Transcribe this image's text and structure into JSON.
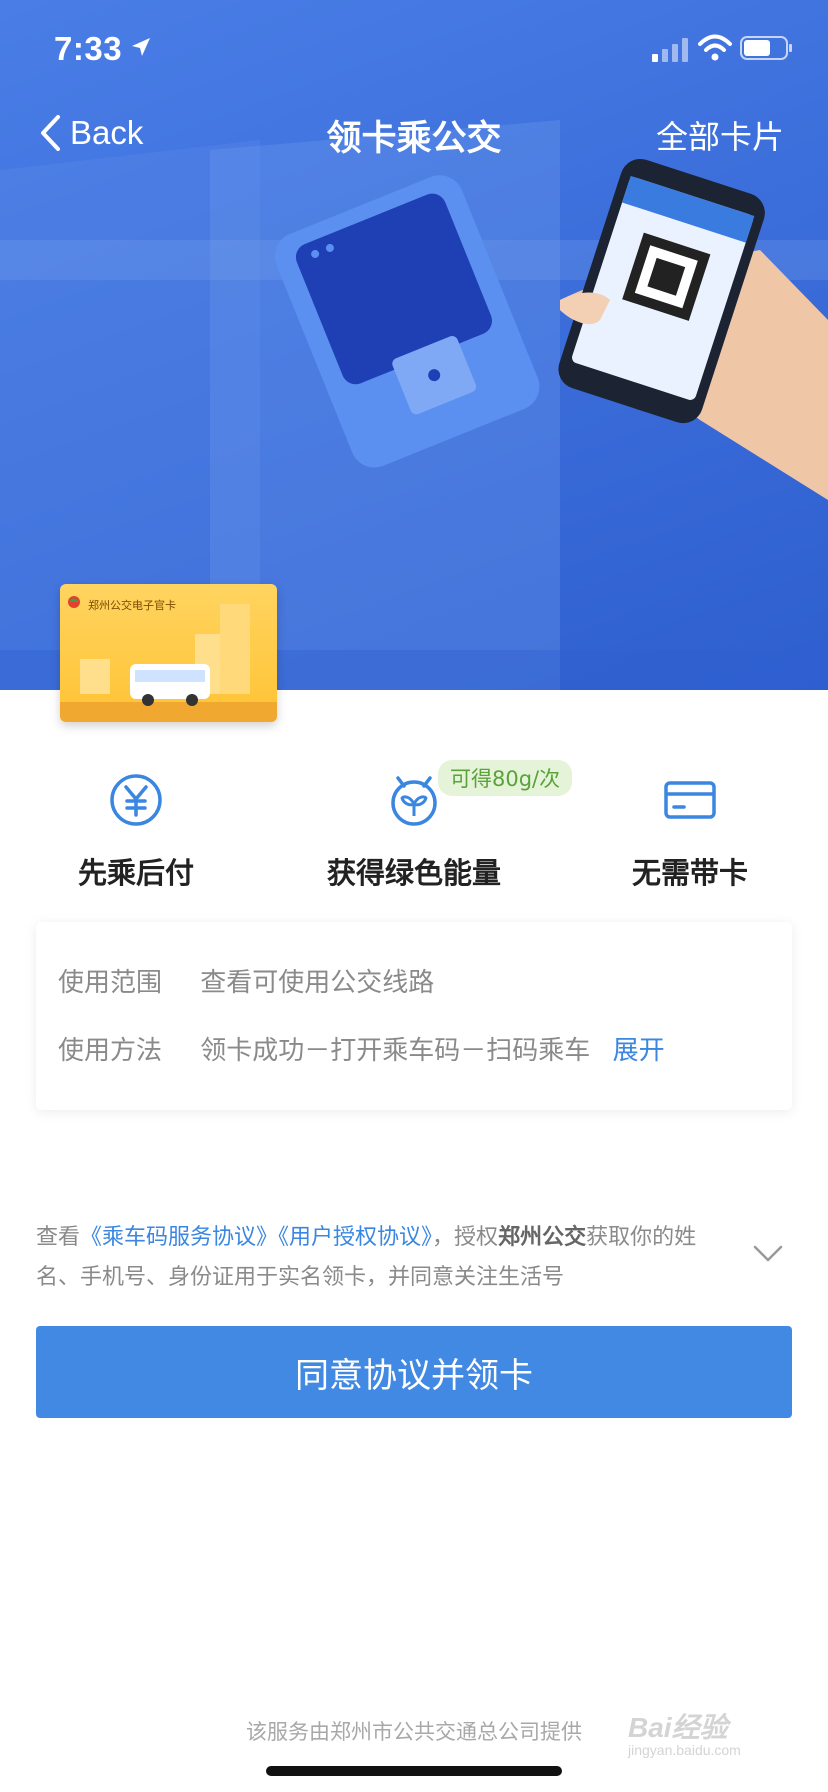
{
  "status_bar": {
    "time": "7:33"
  },
  "nav": {
    "back_label": "Back",
    "title": "领卡乘公交",
    "all_cards": "全部卡片"
  },
  "card": {
    "brand": "郑州公交电子官卡"
  },
  "features": [
    {
      "label": "先乘后付",
      "icon": "yuan-icon"
    },
    {
      "label": "获得绿色能量",
      "icon": "sprout-icon",
      "badge": "可得80g/次"
    },
    {
      "label": "无需带卡",
      "icon": "card-icon"
    }
  ],
  "info": {
    "scope_label": "使用范围",
    "scope_link": "查看可使用公交线路",
    "method_label": "使用方法",
    "method_text": "领卡成功－打开乘车码－扫码乘车",
    "method_expand": "展开"
  },
  "agreement": {
    "prefix": "查看",
    "link1": "《乘车码服务协议》",
    "link2": "《用户授权协议》",
    "mid": "，授权",
    "company": "郑州公交",
    "suffix": "获取你的姓名、手机号、身份证用于实名领卡，并同意关注生活号"
  },
  "cta_label": "同意协议并领卡",
  "footer": "该服务由郑州市公共交通总公司提供",
  "watermark": {
    "main": "Bai经验",
    "sub": "jingyan.baidu.com"
  },
  "colors": {
    "hero": "#3d6fdc",
    "accent": "#4289e3",
    "badge_bg": "#e5f4d9",
    "badge_text": "#5aa23a"
  }
}
